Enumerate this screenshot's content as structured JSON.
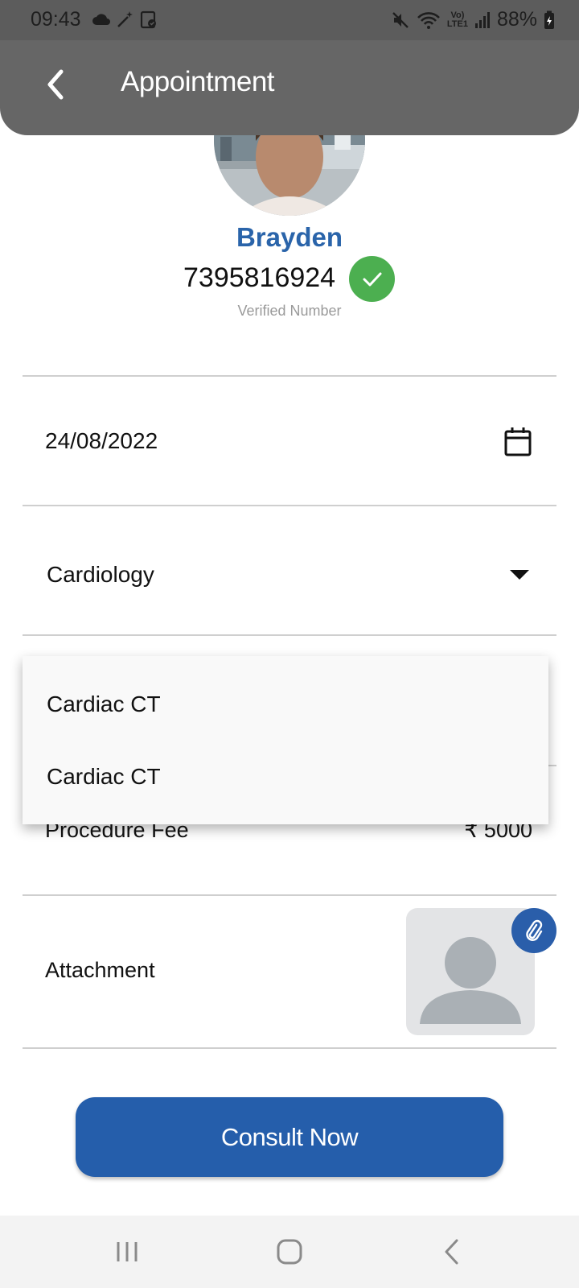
{
  "status_bar": {
    "time": "09:43",
    "battery": "88%",
    "network_top": "Vo)",
    "network_bottom": "LTE1",
    "left_icons": [
      "cloud-icon",
      "magic-wand-icon",
      "clipboard-icon"
    ],
    "right_icons": [
      "mute-icon",
      "wifi-icon",
      "signal-icon",
      "battery-charging-icon"
    ]
  },
  "app_bar": {
    "title": "Appointment",
    "back_icon": "chevron-left-icon"
  },
  "profile": {
    "name": "Brayden",
    "phone": "7395816924",
    "verified_label": "Verified Number",
    "name_color": "#2a64aa",
    "verified_color": "#4caf50"
  },
  "form": {
    "date": "24/08/2022",
    "department": "Cardiology",
    "fee_label": "Procedure Fee",
    "fee_value": "₹ 5000",
    "attachment_label": "Attachment"
  },
  "dropdown": {
    "options": [
      "Cardiac CT",
      "Cardiac CT"
    ]
  },
  "actions": {
    "consult_label": "Consult Now",
    "button_color": "#255eab"
  },
  "nav_bar": {
    "buttons": [
      "recent-apps-icon",
      "home-icon",
      "back-icon"
    ]
  }
}
